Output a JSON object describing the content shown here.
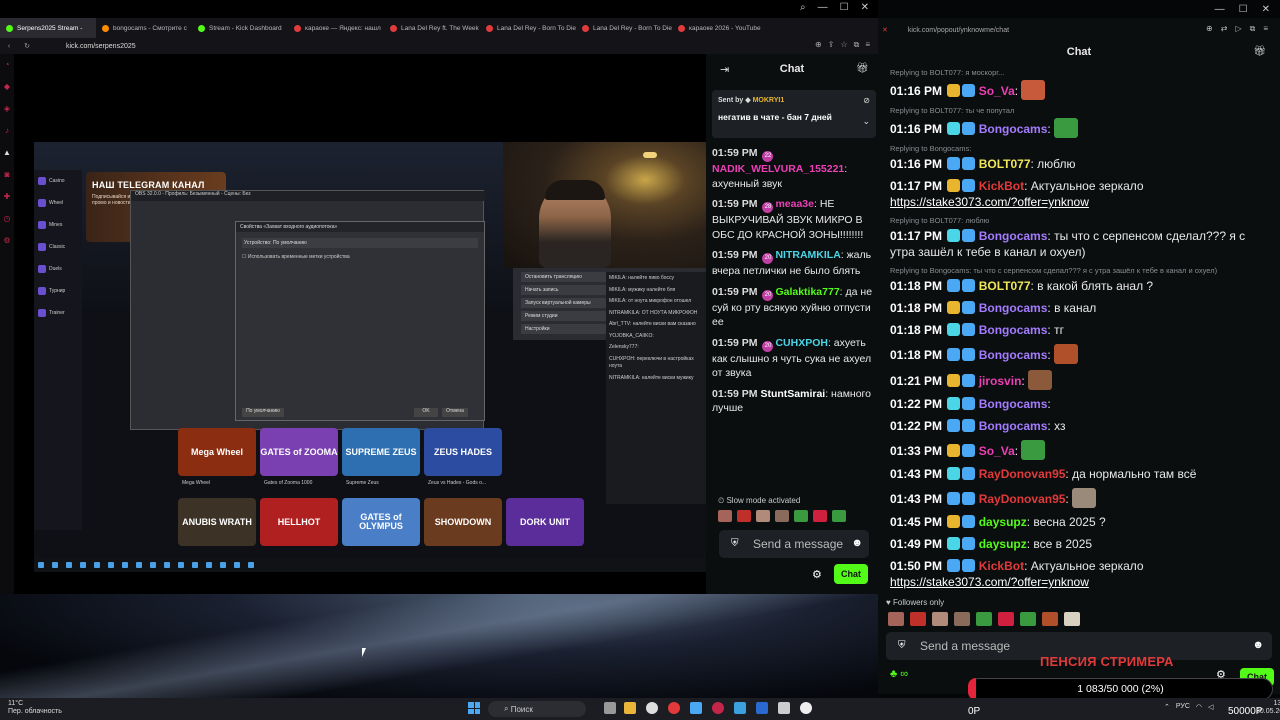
{
  "browser": {
    "tabs": [
      {
        "label": "Serpens2025 Stream -",
        "color": "#53fc18",
        "active": true
      },
      {
        "label": "bongocams - Смотрите с",
        "color": "#ff8c00",
        "active": false
      },
      {
        "label": "Stream - Kick Dashboard",
        "color": "#53fc18",
        "active": false
      },
      {
        "label": "караоке — Яндекс: нашл",
        "color": "#e23a3a",
        "active": false
      },
      {
        "label": "Lana Del Rey ft. The Week",
        "color": "#e23a3a",
        "active": false
      },
      {
        "label": "Lana Del Rey - Born To Die",
        "color": "#e23a3a",
        "active": false
      },
      {
        "label": "Lana Del Rey - Born To Die",
        "color": "#e23a3a",
        "active": false
      },
      {
        "label": "караоке 2026 - YouTube",
        "color": "#e23a3a",
        "active": false
      }
    ],
    "url": "kick.com/serpens2025",
    "popout_url": "kick.com/popout/ynknowme/chat"
  },
  "stream": {
    "tg_title": "НАШ TELEGRAM КАНАЛ",
    "tg_sub": "Подписывайся и получай эксклюзивные промо и новости",
    "obs_title": "OBS 32.0.0 - Профиль: Безымянный - Сцены: Без",
    "obs_dlg_title": "Свойства «Захват входного аудиопотока»",
    "obs_device_label": "Устройство",
    "obs_device_value": "По умолчанию",
    "obs_checkbox": "Использовать временные метки устройства",
    "obs_ok": "OK",
    "obs_cancel": "Отмена",
    "obs_default": "По умолчанию",
    "obs_buttons": [
      "Остановить трансляцию",
      "Начать запись",
      "Запуск виртуальной камеры",
      "Режим студии",
      "Настройки"
    ],
    "mini_chat_lines": [
      "MIKILA: налейте пиво боссу",
      "MIKILA: мужику налейте бля",
      "MIKILA: от ноута микрофон отошел",
      "NITRAMKILA: ОТ НОУТА МИКРОФОН",
      "Abrl_TTV: налейте виски вам сказано",
      "YOJOBKA_CAIIKO:",
      "Zelensky777:",
      "CUHXPOH: переключи в настройках ноута",
      "NITRAMKILA: налейте виски мужику"
    ],
    "tiles": [
      {
        "name": "Mega Wheel",
        "label": "Mega Wheel",
        "bg": "#8b2d10"
      },
      {
        "name": "GATES of ZOOMA",
        "label": "Gates of Zooma 1000",
        "bg": "#7a3fb0"
      },
      {
        "name": "SUPREME ZEUS",
        "label": "Supreme Zeus",
        "bg": "#2d6fb0"
      },
      {
        "name": "ZEUS HADES",
        "label": "Zeus vs Hades - Gods o...",
        "bg": "#2b4ca0"
      },
      {
        "name": "ANUBIS WRATH",
        "label": "",
        "bg": "#3d3226"
      },
      {
        "name": "HELLHOT",
        "label": "",
        "bg": "#b02020"
      },
      {
        "name": "GATES of OLYMPUS",
        "label": "",
        "bg": "#4a7fc8"
      },
      {
        "name": "SHOWDOWN",
        "label": "",
        "bg": "#6a3b1f"
      },
      {
        "name": "DORK UNIT",
        "label": "",
        "bg": "#5a2d9a"
      }
    ],
    "casino_nav": [
      "Casino",
      "Wheel",
      "Mines",
      "Classic",
      "Duels",
      "Турнир",
      "Trainer"
    ]
  },
  "chat1": {
    "title": "Chat",
    "pinned": {
      "sent_by": "Sent by",
      "user": "MOKRYI1",
      "message": "негатив в чате - бан 7 дней"
    },
    "messages": [
      {
        "time": "01:59 PM",
        "badge": "22",
        "user": "NADIK_WELVURA_155221",
        "color": "#ec3fb6",
        "text": ": ахуенный звук"
      },
      {
        "time": "01:59 PM",
        "badge": "28",
        "user": "meaa3e",
        "color": "#ec3fb6",
        "text": ": НЕ ВЫКРУЧИВАЙ ЗВУК МИКРО В ОБС ДО КРАСНОЙ ЗОНЫ!!!!!!!!"
      },
      {
        "time": "01:59 PM",
        "badge": "20",
        "user": "NITRAMKILA",
        "color": "#4ad6e6",
        "text": ": жаль вчера петлички не было блять"
      },
      {
        "time": "01:59 PM",
        "badge": "20",
        "user": "Galaktika777",
        "color": "#53fc18",
        "text": ": да не суй ко рту всякую хуйню отпусти ее"
      },
      {
        "time": "01:59 PM",
        "badge": "20",
        "user": "CUHXPOH",
        "color": "#4ad6e6",
        "text": ": ахуеть как слышно я чуть сука не ахуел от звука"
      },
      {
        "time": "01:59 PM",
        "badge": "",
        "user": "StuntSamirai",
        "color": "#ffffff",
        "text": ": намного лучше"
      }
    ],
    "slow_mode": "Slow mode activated",
    "send_placeholder": "Send a message",
    "chat_button": "Chat"
  },
  "chat2": {
    "title": "Chat",
    "messages": [
      {
        "reply": "Replying to BOLT077: я москорг...",
        "time": "01:16 PM",
        "user": "So_Va",
        "color": "#ec3fb6",
        "text": ":",
        "emote": "#c65a3a"
      },
      {
        "reply": "Replying to BOLT077: ты че попутал",
        "time": "01:16 PM",
        "user": "Bongocams",
        "color": "#a37cff",
        "text": ":",
        "emote": "#3a9a40"
      },
      {
        "reply": "Replying to Bongocams:",
        "time": "01:16 PM",
        "user": "BOLT077",
        "color": "#f0e65a",
        "text": ": люблю",
        "emote": ""
      },
      {
        "reply": "",
        "time": "01:17 PM",
        "user": "KickBot",
        "color": "#e23a3a",
        "text": ": Актуальное зеркало ",
        "link": "https://stake3073.com/?offer=ynknow",
        "emote": ""
      },
      {
        "reply": "Replying to BOLT077: люблю",
        "time": "01:17 PM",
        "user": "Bongocams",
        "color": "#a37cff",
        "text": ": ты что с серпенсом сделал??? я с утра зашёл к тебе в канал и охуел)",
        "emote": ""
      },
      {
        "reply": "Replying to Bongocams: ты что с серпенсом сделал??? я с утра зашёл к тебе в канал и охуел)",
        "time": "01:18 PM",
        "user": "BOLT077",
        "color": "#f0e65a",
        "text": ": в какой блять анал ?",
        "emote": ""
      },
      {
        "reply": "",
        "time": "01:18 PM",
        "user": "Bongocams",
        "color": "#a37cff",
        "text": ": в канал",
        "emote": ""
      },
      {
        "reply": "",
        "time": "01:18 PM",
        "user": "Bongocams",
        "color": "#a37cff",
        "text": ": тг",
        "emote": ""
      },
      {
        "reply": "",
        "time": "01:18 PM",
        "user": "Bongocams",
        "color": "#a37cff",
        "text": ":",
        "emote": "#b0502a"
      },
      {
        "reply": "",
        "time": "01:21 PM",
        "user": "jirosvin",
        "color": "#ec3fb6",
        "text": ":",
        "emote": "#8a5a3a"
      },
      {
        "reply": "",
        "time": "01:22 PM",
        "user": "Bongocams",
        "color": "#a37cff",
        "text": ":",
        "emote": ""
      },
      {
        "reply": "",
        "time": "01:22 PM",
        "user": "Bongocams",
        "color": "#a37cff",
        "text": ": хз",
        "emote": ""
      },
      {
        "reply": "",
        "time": "01:33 PM",
        "user": "So_Va",
        "color": "#ec3fb6",
        "text": ":",
        "emote": "#3a9a40"
      },
      {
        "reply": "",
        "time": "01:43 PM",
        "user": "RayDonovan95",
        "color": "#e23a3a",
        "text": ": да нормально там всё",
        "emote": ""
      },
      {
        "reply": "",
        "time": "01:43 PM",
        "user": "RayDonovan95",
        "color": "#e23a3a",
        "text": ":",
        "emote": "#9a8a7a"
      },
      {
        "reply": "",
        "time": "01:45 PM",
        "user": "daysupz",
        "color": "#53fc18",
        "text": ": весна 2025 ?",
        "emote": ""
      },
      {
        "reply": "",
        "time": "01:49 PM",
        "user": "daysupz",
        "color": "#53fc18",
        "text": ": все в 2025",
        "emote": ""
      },
      {
        "reply": "",
        "time": "01:50 PM",
        "user": "KickBot",
        "color": "#e23a3a",
        "text": ": Актуальное зеркало ",
        "link": "https://stake3073.com/?offer=ynknow",
        "emote": ""
      }
    ],
    "followers_only": "Followers only",
    "send_placeholder": "Send a message",
    "chat_button": "Chat"
  },
  "overlay": {
    "title": "ПЕНСИЯ СТРИМЕРА",
    "goal": "1 083/50 000 (2%)",
    "goal_fraction": 0.02,
    "left_label": "0Р",
    "right_label": "50000Р"
  },
  "taskbar": {
    "weather_temp": "11°C",
    "weather_desc": "Пер. облачность",
    "search": "Поиск",
    "lang": "РУС",
    "time": "13:59",
    "date": "30.05.2025"
  }
}
